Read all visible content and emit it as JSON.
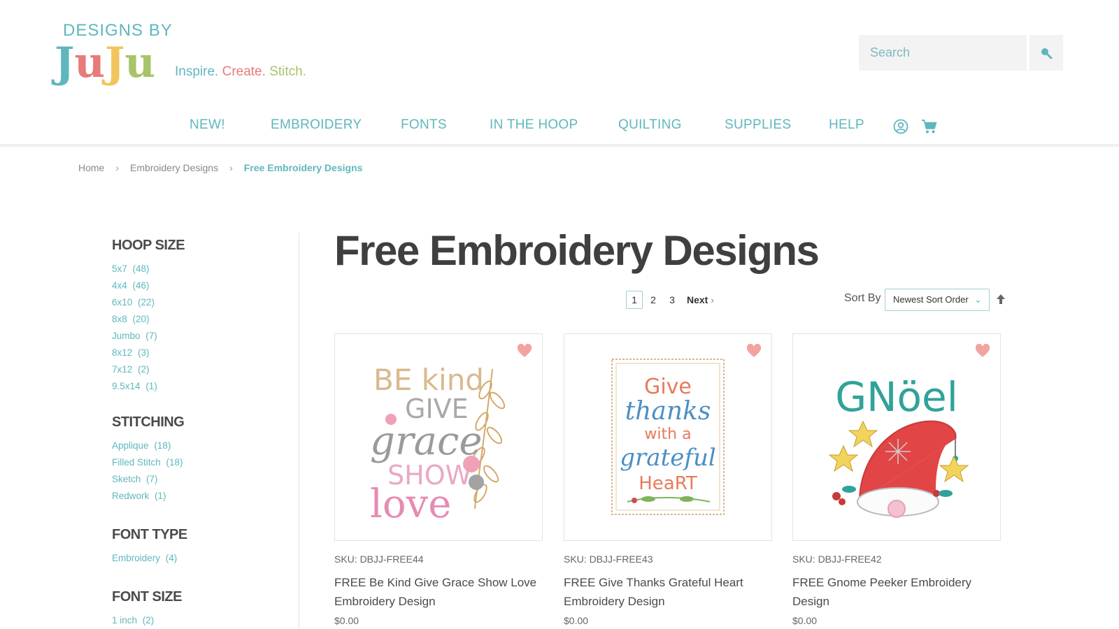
{
  "header": {
    "logo_top": "DESIGNS BY",
    "logo_juju": [
      "J",
      "u",
      "J",
      "u"
    ],
    "tagline": [
      "Inspire.",
      "Create.",
      "Stitch."
    ],
    "search_placeholder": "Search"
  },
  "nav": {
    "items": [
      "NEW!",
      "EMBROIDERY",
      "FONTS",
      "IN THE HOOP",
      "QUILTING",
      "SUPPLIES",
      "HELP"
    ]
  },
  "breadcrumb": [
    "Home",
    "Embroidery Designs",
    "Free Embroidery Designs"
  ],
  "sidebar": {
    "facets": [
      {
        "title": "HOOP SIZE",
        "options": [
          {
            "label": "5x7",
            "count": "(48)"
          },
          {
            "label": "4x4",
            "count": "(46)"
          },
          {
            "label": "6x10",
            "count": "(22)"
          },
          {
            "label": "8x8",
            "count": "(20)"
          },
          {
            "label": "Jumbo",
            "count": "(7)"
          },
          {
            "label": "8x12",
            "count": "(3)"
          },
          {
            "label": "7x12",
            "count": "(2)"
          },
          {
            "label": "9.5x14",
            "count": "(1)"
          }
        ]
      },
      {
        "title": "STITCHING",
        "options": [
          {
            "label": "Applique",
            "count": "(18)"
          },
          {
            "label": "Filled Stitch",
            "count": "(18)"
          },
          {
            "label": "Sketch",
            "count": "(7)"
          },
          {
            "label": "Redwork",
            "count": "(1)"
          }
        ]
      },
      {
        "title": "FONT TYPE",
        "options": [
          {
            "label": "Embroidery",
            "count": "(4)"
          }
        ]
      },
      {
        "title": "FONT SIZE",
        "options": [
          {
            "label": "1 inch",
            "count": "(2)"
          }
        ]
      }
    ]
  },
  "main": {
    "title": "Free Embroidery Designs",
    "pagination": {
      "pages": [
        "1",
        "2",
        "3"
      ],
      "current": "1",
      "next": "Next"
    },
    "sort": {
      "label": "Sort By",
      "selected": "Newest Sort Order"
    },
    "products": [
      {
        "sku": "SKU: DBJJ-FREE44",
        "name": "FREE Be Kind Give Grace Show Love Embroidery Design",
        "price": "$0.00",
        "art": [
          "BE kind",
          "GIVE",
          "grace",
          "SHOW",
          "love"
        ]
      },
      {
        "sku": "SKU: DBJJ-FREE43",
        "name": "FREE Give Thanks Grateful Heart Embroidery Design",
        "price": "$0.00",
        "art": [
          "Give",
          "thanks",
          "with a",
          "grateful",
          "HeaRT"
        ]
      },
      {
        "sku": "SKU: DBJJ-FREE42",
        "name": "FREE Gnome Peeker Embroidery Design",
        "price": "$0.00",
        "art": [
          "GNöel"
        ]
      }
    ]
  },
  "colors": {
    "teal": "#5fb7bd",
    "coral": "#e87a7a",
    "green": "#a7c46b",
    "heart": "#f2a3a0"
  }
}
